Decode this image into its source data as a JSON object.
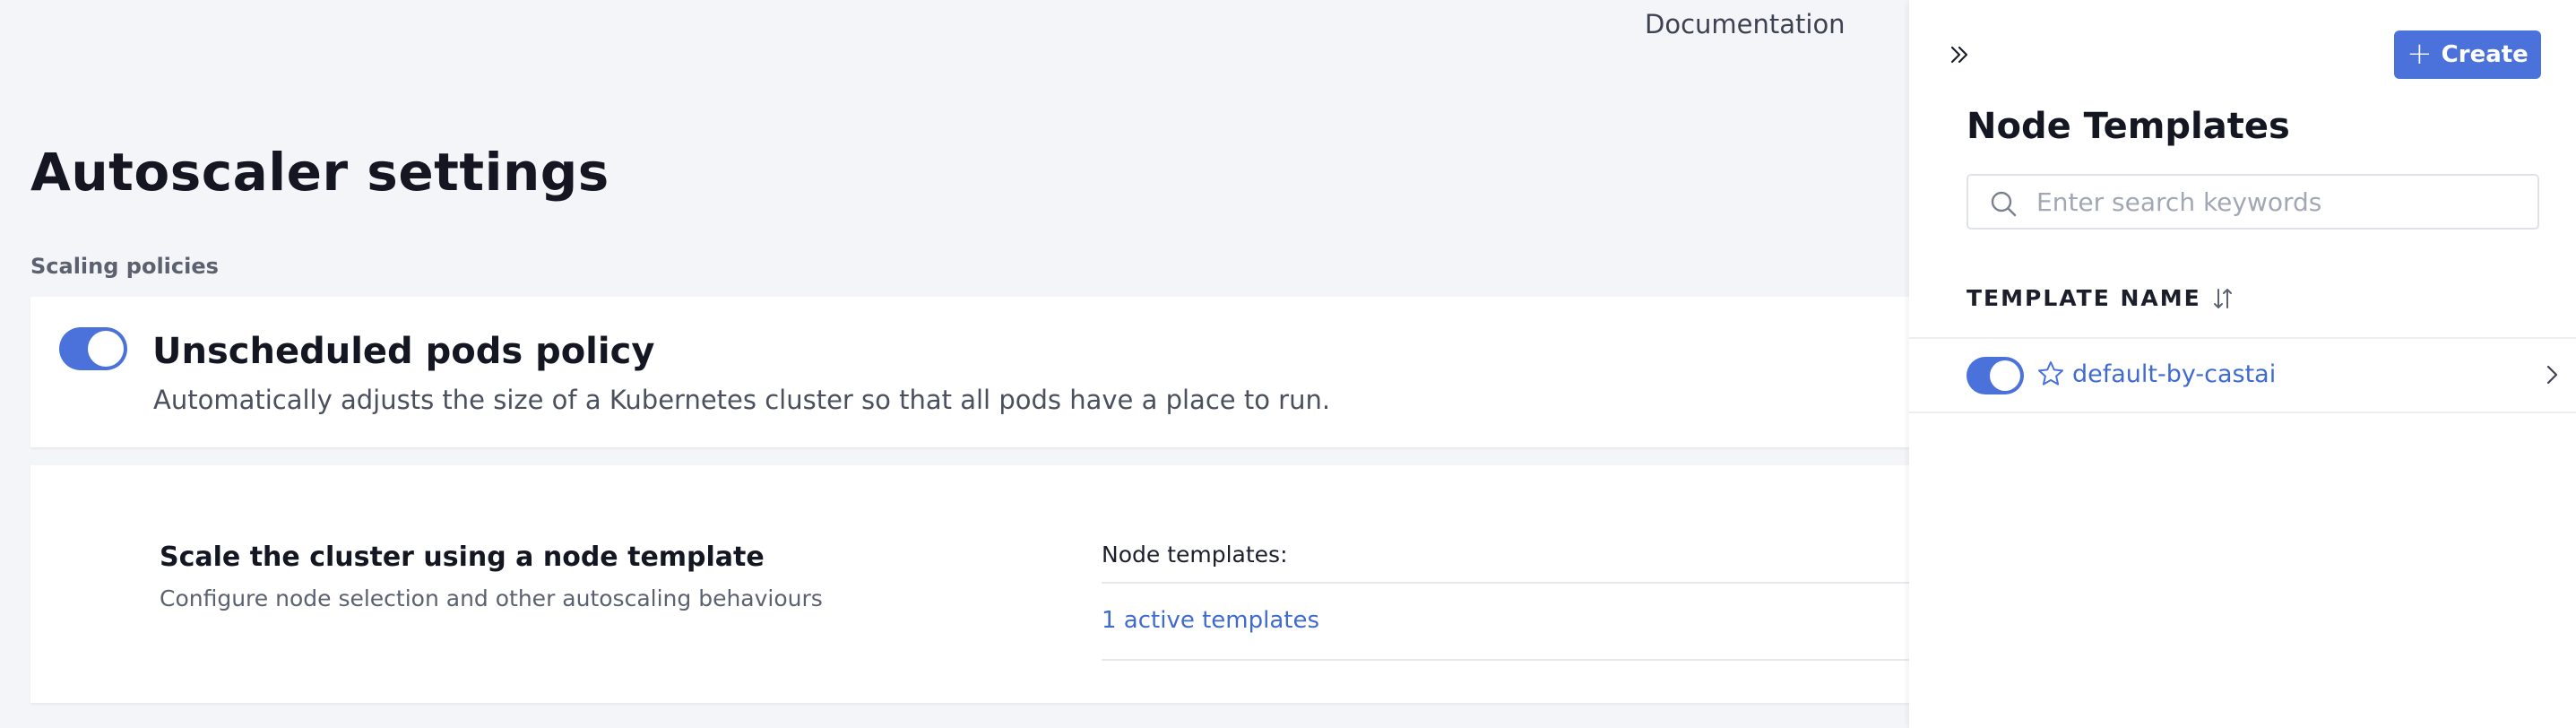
{
  "header": {
    "documentation_label": "Documentation"
  },
  "page": {
    "title": "Autoscaler settings",
    "section_label": "Scaling policies"
  },
  "policy": {
    "title": "Unscheduled pods policy",
    "description": "Automatically adjusts the size of a Kubernetes cluster so that all pods have a place to run.",
    "enabled": true
  },
  "template_section": {
    "title": "Scale the cluster using a node template",
    "description": "Configure node selection and other autoscaling behaviours",
    "node_templates_label": "Node templates:",
    "active_templates_link": "1 active templates"
  },
  "drawer": {
    "title": "Node Templates",
    "create_label": "Create",
    "search_placeholder": "Enter search keywords",
    "column_header": "TEMPLATE NAME",
    "templates": [
      {
        "name": "default-by-castai",
        "enabled": true,
        "starred": false
      }
    ]
  },
  "colors": {
    "accent": "#4a72da",
    "link": "#3f6bd1",
    "background": "#f4f5f8"
  }
}
